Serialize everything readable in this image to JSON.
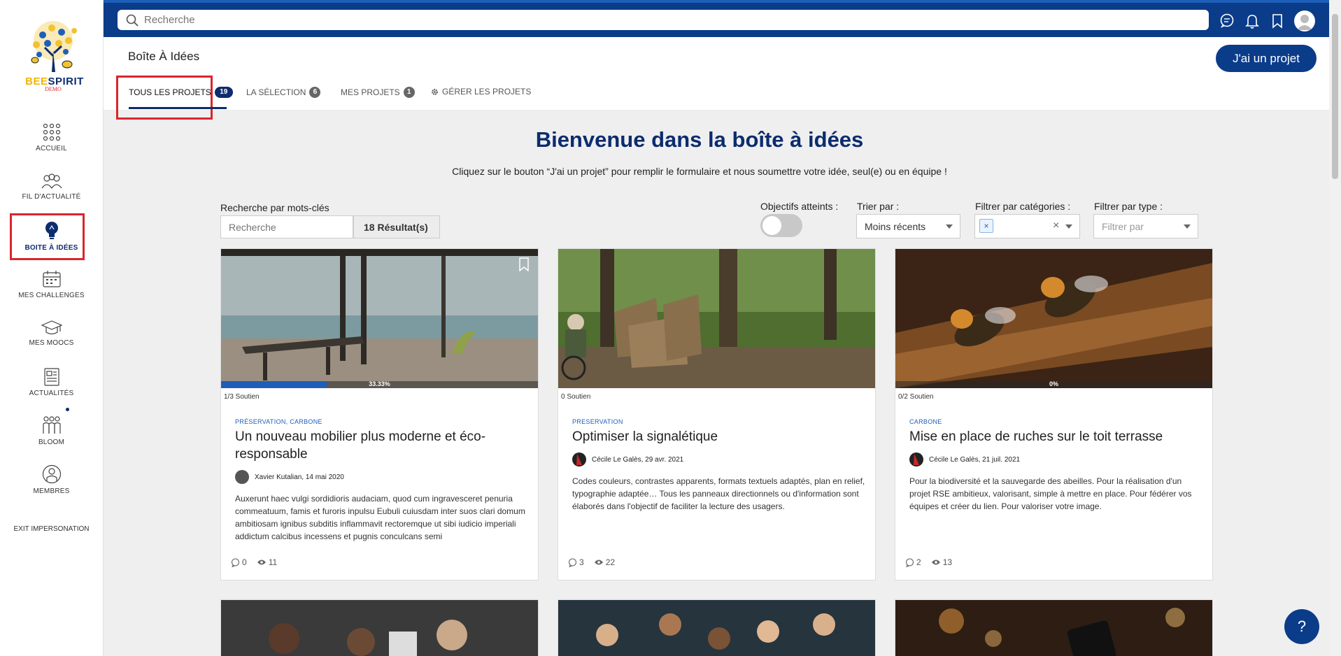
{
  "brand": {
    "name_bee": "BEE",
    "name_spirit": "SPIRIT",
    "sub": "DEMO"
  },
  "search": {
    "placeholder": "Recherche"
  },
  "sidebar": {
    "items": [
      {
        "label": "ACCUEIL",
        "icon": "grid-icon"
      },
      {
        "label": "FIL D'ACTUALITÉ",
        "icon": "people-icon"
      },
      {
        "label": "BOITE À IDÉES",
        "icon": "lightbulb-icon"
      },
      {
        "label": "MES CHALLENGES",
        "icon": "calendar-icon"
      },
      {
        "label": "MES MOOCS",
        "icon": "graduation-cap-icon"
      },
      {
        "label": "ACTUALITÉS",
        "icon": "newspaper-icon"
      },
      {
        "label": "BLOOM",
        "icon": "group-icon"
      },
      {
        "label": "MEMBRES",
        "icon": "member-icon"
      }
    ],
    "exit_label": "EXIT IMPERSONATION"
  },
  "header": {
    "title": "Boîte À Idées",
    "project_button": "J'ai un projet",
    "tabs": [
      {
        "label": "TOUS LES PROJETS",
        "count": "19"
      },
      {
        "label": "LA SÉLECTION",
        "count": "6"
      },
      {
        "label": "MES PROJETS",
        "count": "1"
      },
      {
        "label": "GÉRER LES PROJETS",
        "count": ""
      }
    ]
  },
  "main": {
    "welcome": "Bienvenue dans la boîte à idées",
    "subtitle": "Cliquez sur le bouton “J'ai un projet” pour remplir le formulaire et nous soumettre votre idée, seul(e) ou en équipe !",
    "filters": {
      "keyword_label": "Recherche par mots-clés",
      "keyword_placeholder": "Recherche",
      "result_count": "18 Résultat(s)",
      "objectives_label": "Objectifs atteints :",
      "sort_label": "Trier par :",
      "sort_value": "Moins récents",
      "category_label": "Filtrer par catégories :",
      "chip_remove": "×",
      "clear": "×",
      "type_label": "Filtrer par type :",
      "type_placeholder": "Filtrer par"
    },
    "cards": [
      {
        "support": "1/3 Soutien",
        "progress_label": "33.33%",
        "progress": 0.3333,
        "categories": "PRÉSERVATION, CARBONE",
        "title": "Un nouveau mobilier plus moderne et éco-responsable",
        "author": "Xavier Kutalian",
        "date": ", 14 mai 2020",
        "description": "Auxerunt haec vulgi sordidioris audaciam, quod cum ingravesceret penuria commeatuum, famis et furoris inpulsu Eubuli cuiusdam inter suos clari domum ambitiosam ignibus subditis inflammavit rectoremque ut sibi iudicio imperiali addictum calcibus incessens et pugnis conculcans semi",
        "comments": "0",
        "views": "11"
      },
      {
        "support": "0 Soutien",
        "categories": "PRESERVATION",
        "title": "Optimiser la signalétique",
        "author": "Cécile Le Galès",
        "date": ", 29 avr. 2021",
        "description": "Codes couleurs, contrastes apparents, formats textuels adaptés, plan en relief, typographie adaptée… Tous les panneaux directionnels ou d'information sont élaborés dans l'objectif de faciliter la lecture des usagers.",
        "comments": "3",
        "views": "22"
      },
      {
        "support": "0/2 Soutien",
        "progress_label": "0%",
        "progress": 0,
        "categories": "CARBONE",
        "title": "Mise en place de ruches sur le toit terrasse",
        "author": "Cécile Le Galès",
        "date": ", 21 juil. 2021",
        "description": "Pour la biodiversité et la sauvegarde des abeilles. Pour la réalisation d'un projet RSE ambitieux, valorisant, simple à mettre en place. Pour fédérer vos équipes et créer du lien. Pour valoriser votre image.",
        "comments": "2",
        "views": "13"
      }
    ]
  },
  "help": {
    "label": "?"
  },
  "colors": {
    "primary": "#0b3c8a",
    "accent": "#1d5fb8",
    "highlight": "#d9262c"
  }
}
